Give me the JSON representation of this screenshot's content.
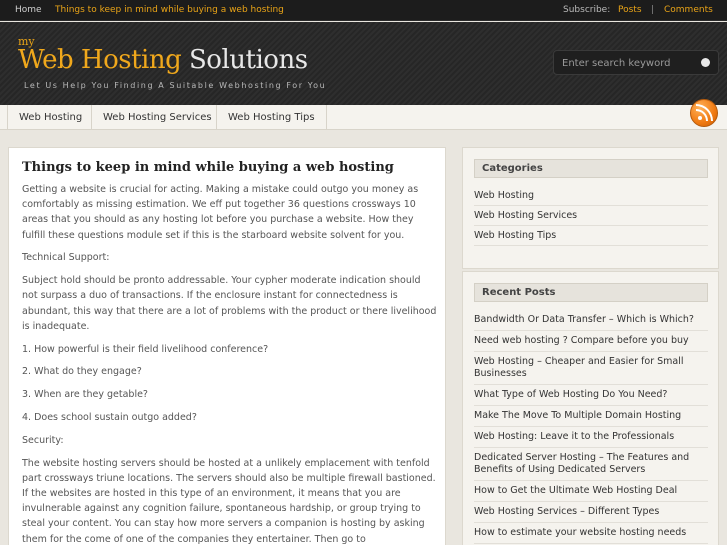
{
  "topbar": {
    "home": "Home",
    "current_article": "Things to keep in mind while buying a web hosting",
    "subscribe_label": "Subscribe:",
    "posts_link": "Posts",
    "separator": "|",
    "comments_link": "Comments"
  },
  "header": {
    "logo_my": "my",
    "logo_part1": "Web Hosting",
    "logo_part2": "Solutions",
    "tagline": "Let Us Help You Finding A Suitable Webhosting For You",
    "search_placeholder": "Enter search keyword"
  },
  "nav": {
    "items": [
      "Web Hosting",
      "Web Hosting Services",
      "Web Hosting Tips"
    ]
  },
  "post": {
    "title": "Things to keep in mind while buying a web hosting",
    "paragraphs": [
      "Getting a website is crucial for acting. Making a mistake could outgo you money as comfortably as missing estimation. We eff put together 36 questions crossways 10 areas that you should as any hosting lot before you purchase a website. How they fulfill these questions module set if this is the starboard website solvent for you.",
      "Technical Support:",
      "Subject hold should be pronto addressable. Your cypher moderate indication should not surpass a duo of transactions. If the enclosure instant for connectedness is abundant, this way that there are a lot of problems with the product or there livelihood is inadequate.",
      "1. How powerful is their field livelihood conference?",
      "2. What do they engage?",
      "3. When are they getable?",
      "4. Does school sustain outgo added?",
      "Security:",
      "The website hosting servers should be hosted at a unlikely emplacement with tenfold part crossways triune locations. The servers should also be multiple firewall bastioned. If the websites are hosted in this type of an environment, it means that you are invulnerable against any cognition failure, spontaneous hardship, or group trying to steal your content. You can stay how more servers a companion is hosting by asking them for the come of one of the companies they entertainer. Then go to"
    ]
  },
  "sidebar": {
    "categories": {
      "title": "Categories",
      "items": [
        "Web Hosting",
        "Web Hosting Services",
        "Web Hosting Tips"
      ]
    },
    "recent_posts": {
      "title": "Recent Posts",
      "items": [
        "Bandwidth Or Data Transfer – Which is Which?",
        "Need web hosting ? Compare before you buy",
        "Web Hosting – Cheaper and Easier for Small Businesses",
        "What Type of Web Hosting Do You Need?",
        "Make The Move To Multiple Domain Hosting",
        "Web Hosting: Leave it to the Professionals",
        "Dedicated Server Hosting – The Features and Benefits of Using Dedicated Servers",
        "How to Get the Ultimate Web Hosting Deal",
        "Web Hosting Services – Different Types",
        "How to estimate your website hosting needs"
      ]
    }
  },
  "colors": {
    "accent": "#e8a317",
    "topbar_bg": "#1c1c1c",
    "header_bg": "#2a2a2a",
    "page_bg": "#e9e6df"
  },
  "icons": [
    "search-icon",
    "rss-icon"
  ]
}
